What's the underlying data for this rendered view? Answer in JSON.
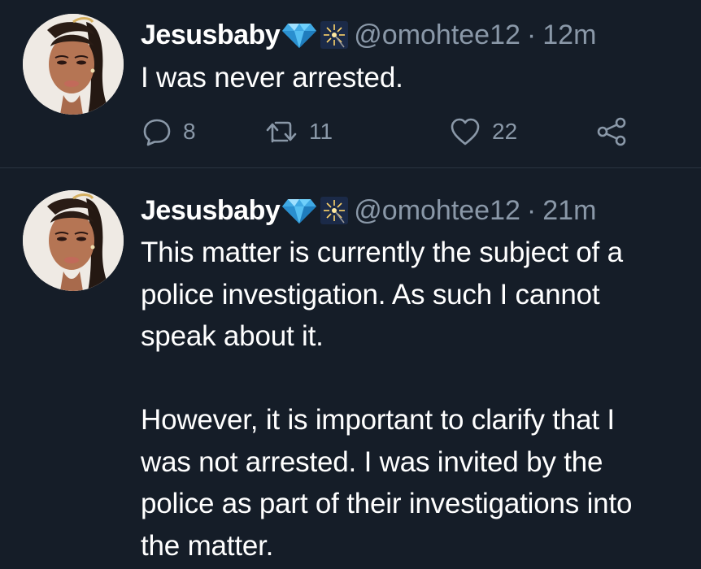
{
  "colors": {
    "background": "#151d28",
    "text_primary": "#ffffff",
    "text_secondary": "#8a98a8",
    "divider": "#2a3440"
  },
  "tweets": [
    {
      "display_name": "Jesusbaby",
      "name_emojis": [
        "gem-stone-emoji",
        "sparkler-emoji"
      ],
      "handle": "@omohtee12",
      "separator": "·",
      "time": "12m",
      "text": "I was never arrested.",
      "actions": {
        "reply_icon": "reply-icon",
        "reply_count": "8",
        "retweet_icon": "retweet-icon",
        "retweet_count": "11",
        "like_icon": "heart-icon",
        "like_count": "22",
        "share_icon": "share-icon"
      }
    },
    {
      "display_name": "Jesusbaby",
      "name_emojis": [
        "gem-stone-emoji",
        "sparkler-emoji"
      ],
      "handle": "@omohtee12",
      "separator": "·",
      "time": "21m",
      "text": "This matter is currently the subject of a\npolice investigation. As such I cannot\nspeak about it.\n\nHowever, it is important to clarify that I\nwas not arrested. I was invited by the\npolice as part of their investigations into\nthe matter."
    }
  ]
}
